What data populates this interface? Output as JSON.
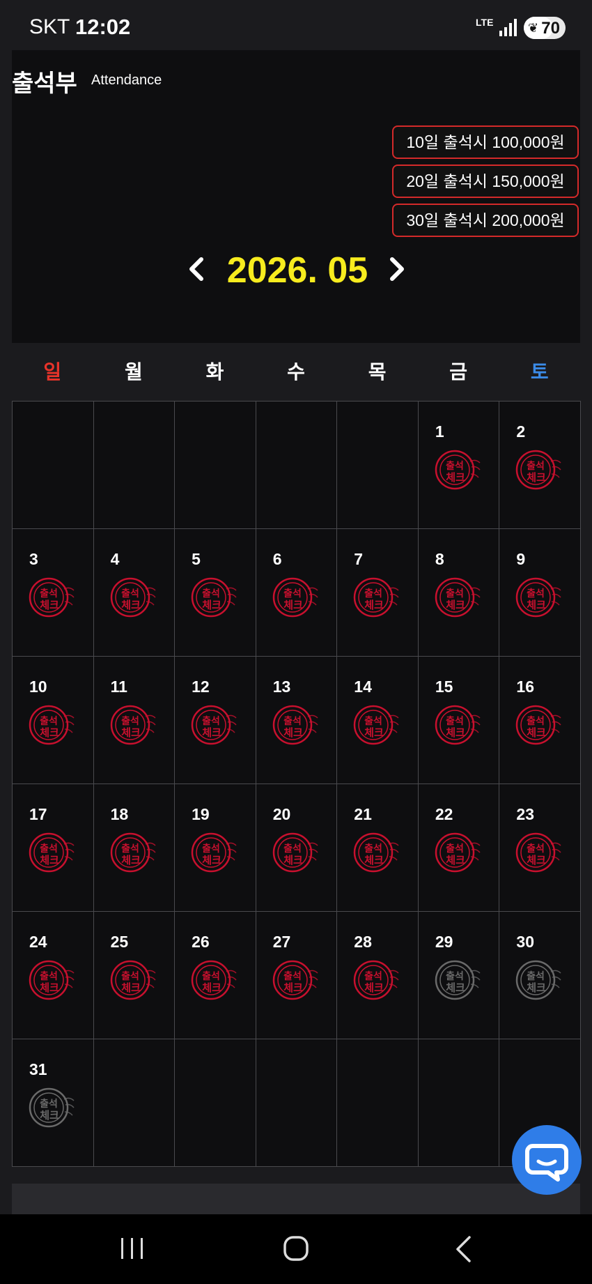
{
  "status_bar": {
    "carrier": "SKT",
    "time": "12:02",
    "network": "LTE",
    "battery": "70"
  },
  "header": {
    "title": "출석부",
    "subtitle": "Attendance"
  },
  "rewards": [
    "10일 출석시 100,000원",
    "20일 출석시 150,000원",
    "30일 출석시 200,000원"
  ],
  "month_nav": {
    "label": "2026. 05",
    "prev_icon": "chevron-left-icon",
    "next_icon": "chevron-right-icon"
  },
  "weekdays": [
    "일",
    "월",
    "화",
    "수",
    "목",
    "금",
    "토"
  ],
  "colors": {
    "sunday": "#e8332a",
    "saturday": "#3b8be8",
    "month_label": "#f7ec1e",
    "stamp_checked": "#c8102e",
    "stamp_unchecked": "#6a6a6a",
    "reward_border": "#d42a2a"
  },
  "calendar": {
    "first_weekday_index": 5,
    "days": [
      {
        "day": "1",
        "checked": true
      },
      {
        "day": "2",
        "checked": true
      },
      {
        "day": "3",
        "checked": true
      },
      {
        "day": "4",
        "checked": true
      },
      {
        "day": "5",
        "checked": true
      },
      {
        "day": "6",
        "checked": true
      },
      {
        "day": "7",
        "checked": true
      },
      {
        "day": "8",
        "checked": true
      },
      {
        "day": "9",
        "checked": true
      },
      {
        "day": "10",
        "checked": true
      },
      {
        "day": "11",
        "checked": true
      },
      {
        "day": "12",
        "checked": true
      },
      {
        "day": "13",
        "checked": true
      },
      {
        "day": "14",
        "checked": true
      },
      {
        "day": "15",
        "checked": true
      },
      {
        "day": "16",
        "checked": true
      },
      {
        "day": "17",
        "checked": true
      },
      {
        "day": "18",
        "checked": true
      },
      {
        "day": "19",
        "checked": true
      },
      {
        "day": "20",
        "checked": true
      },
      {
        "day": "21",
        "checked": true
      },
      {
        "day": "22",
        "checked": true
      },
      {
        "day": "23",
        "checked": true
      },
      {
        "day": "24",
        "checked": true
      },
      {
        "day": "25",
        "checked": true
      },
      {
        "day": "26",
        "checked": true
      },
      {
        "day": "27",
        "checked": true
      },
      {
        "day": "28",
        "checked": true
      },
      {
        "day": "29",
        "checked": false
      },
      {
        "day": "30",
        "checked": false
      },
      {
        "day": "31",
        "checked": false
      }
    ],
    "total_cells": 42,
    "stamp_text": [
      "출석",
      "체크"
    ]
  },
  "chat_button": {
    "icon": "chat-bubble-icon"
  },
  "nav_bar": {
    "recents_icon": "recents-icon",
    "home_icon": "home-icon",
    "back_icon": "back-icon"
  }
}
